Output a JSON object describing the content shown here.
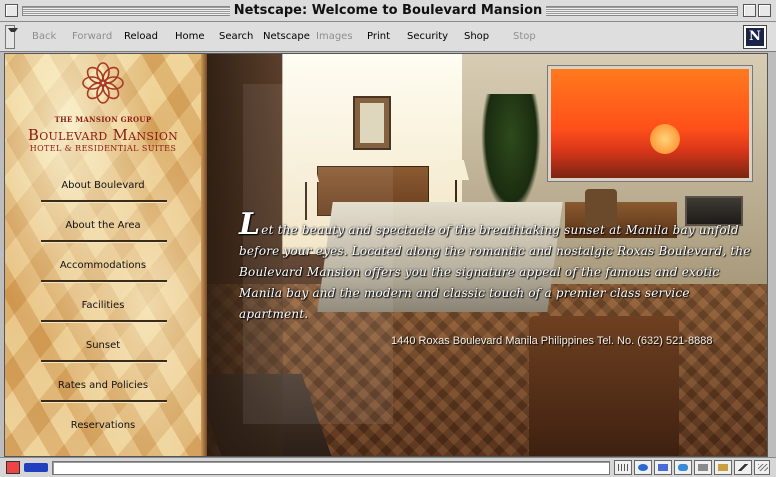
{
  "window": {
    "title": "Netscape: Welcome to Boulevard Mansion"
  },
  "toolbar": {
    "buttons": [
      {
        "label": "Back",
        "enabled": false
      },
      {
        "label": "Forward",
        "enabled": false
      },
      {
        "label": "Reload",
        "enabled": true
      },
      {
        "label": "Home",
        "enabled": true
      },
      {
        "label": "Search",
        "enabled": true
      },
      {
        "label": "Netscape",
        "enabled": true
      },
      {
        "label": "Images",
        "enabled": false
      },
      {
        "label": "Print",
        "enabled": true
      },
      {
        "label": "Security",
        "enabled": true
      },
      {
        "label": "Shop",
        "enabled": true
      },
      {
        "label": "Stop",
        "enabled": false
      }
    ],
    "throbber_letter": "N"
  },
  "sidebar": {
    "group": "THE MANSION GROUP",
    "brand": "Boulevard Mansion",
    "subtitle": "HOTEL & RESIDENTIAL SUITES",
    "nav": [
      {
        "label": "About Boulevard"
      },
      {
        "label": "About the Area"
      },
      {
        "label": "Accommodations"
      },
      {
        "label": "Facilities"
      },
      {
        "label": "Sunset"
      },
      {
        "label": "Rates and Policies"
      },
      {
        "label": "Reservations"
      }
    ]
  },
  "main": {
    "intro_initial": "L",
    "intro_text": "et the beauty and spectacle of the breathtaking sunset at Manila bay unfold before your eyes. Located along the romantic and nostalgic Roxas Boulevard, the Boulevard Mansion offers you the signature appeal of the famous and exotic Manila bay and the modern and classic touch of a premier class service apartment.",
    "address": "1440 Roxas Boulevard Manila Philippines Tel. No. (632) 521-8888"
  },
  "statusbar": {
    "text": ""
  },
  "colors": {
    "brand_red": "#8a1a10",
    "sunset_orange": "#ff5a1a"
  }
}
